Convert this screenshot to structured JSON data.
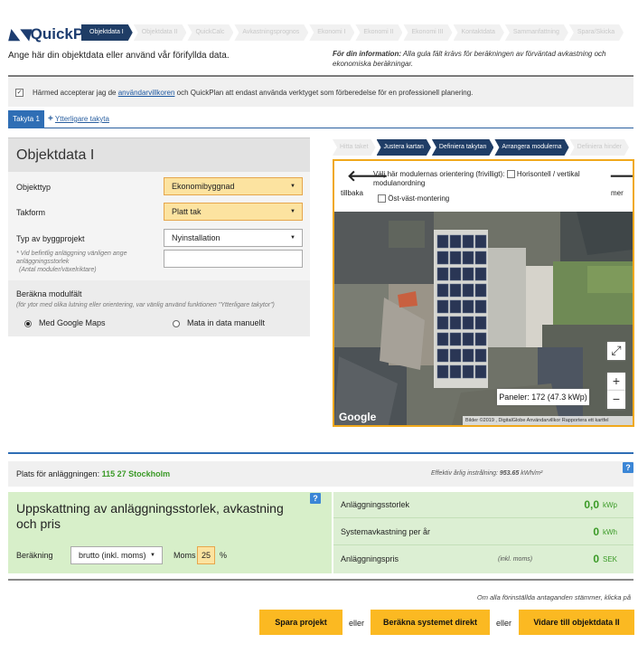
{
  "logo": {
    "text": "QuickPlan"
  },
  "wizard": {
    "steps": [
      "Objektdata I",
      "Objektdata II",
      "QuickCalc",
      "Avkastningsprognos",
      "Ekonomi I",
      "Ekonomi II",
      "Ekonomi III",
      "Kontaktdata",
      "Sammanfattning",
      "Spara/Skicka"
    ],
    "active_index": 0
  },
  "intro": "Ange här din objektdata eller använd vår förifyllda data.",
  "info": {
    "bold": "För din information:",
    "text": " Alla gula fält krävs för beräkningen av förväntad avkastning och ekonomiska beräkningar."
  },
  "consent": {
    "prefix": "Härmed accepterar jag de ",
    "link": "användarvillkoren",
    "suffix": " och QuickPlan att endast använda verktyget som förberedelse för en professionell planering.",
    "checked": true
  },
  "tabs": {
    "active": "Takyta 1",
    "add": "Ytterligare takyta"
  },
  "form": {
    "title": "Objektdata I",
    "objekttyp": {
      "label": "Objekttyp",
      "value": "Ekonomibyggnad"
    },
    "takform": {
      "label": "Takform",
      "value": "Platt tak"
    },
    "byggprojekt": {
      "label": "Typ av byggprojekt",
      "value": "Nyinstallation",
      "note1": "* Vid befintlig anläggning vänligen ange",
      "note2": "anläggningsstorlek",
      "note3": "(Antal moduler/växelriktare)"
    },
    "modulfalt": {
      "label": "Beräkna modulfält",
      "note": "(för ytor med olika lutning eller orientering, var vänlig använd funktionen \"Ytterligare takytor\")",
      "option1": "Med Google Maps",
      "option2": "Mata in data manuellt",
      "selected": 0
    }
  },
  "map": {
    "steps": [
      "Hitta taket",
      "Justera kartan",
      "Definiera takytan",
      "Arrangera modulerna",
      "Definiera hinder"
    ],
    "step_states": [
      "disabled",
      "active",
      "active",
      "active",
      "disabled"
    ],
    "back": "tillbaka",
    "next": "mer",
    "orientation_prompt": "Välj här modulernas orientering (frivilligt):",
    "option_horizontal": "Horisontell / vertikal modulanordning",
    "option_ostvast": "Öst-väst-montering",
    "panels_label": "Paneler: 172 (47.3 kWp)",
    "google": "Google",
    "footer": "Bilder ©2019 , DigitalGlobe   Användarvillkor   Rapportera ett kartfel",
    "zoom_in": "+",
    "zoom_out": "−"
  },
  "plats": {
    "label": "Plats för anläggningen:",
    "value": "115 27 Stockholm",
    "irr_label": "Effektiv årlig instrålning:",
    "irr_value": "953.65",
    "irr_unit": " kWh/m²"
  },
  "estimate": {
    "title": "Uppskattning av anläggningsstorlek, avkastning och pris",
    "berakning_label": "Beräkning",
    "berakning_value": "brutto (inkl. moms)",
    "moms_label": "Moms",
    "moms_value": "25",
    "moms_unit": "%"
  },
  "results": [
    {
      "label": "Anläggningsstorlek",
      "sub": "",
      "value": "0,0",
      "unit": "kWp"
    },
    {
      "label": "Systemavkastning per år",
      "sub": "",
      "value": "0",
      "unit": "kWh"
    },
    {
      "label": "Anläggningspris",
      "sub": "(inkl. moms)",
      "value": "0",
      "unit": "SEK"
    }
  ],
  "footer": {
    "hint": "Om alla förinställda antaganden stämmer, klicka på",
    "save": "Spara projekt",
    "or1": "eller",
    "calc": "Beräkna systemet direkt",
    "or2": "eller",
    "next": "Vidare till objektdata II"
  },
  "colors": {
    "navy": "#1f3d66",
    "accent_blue": "#2f6eb5",
    "yellow": "#fbb922",
    "green": "#3a9a26"
  }
}
